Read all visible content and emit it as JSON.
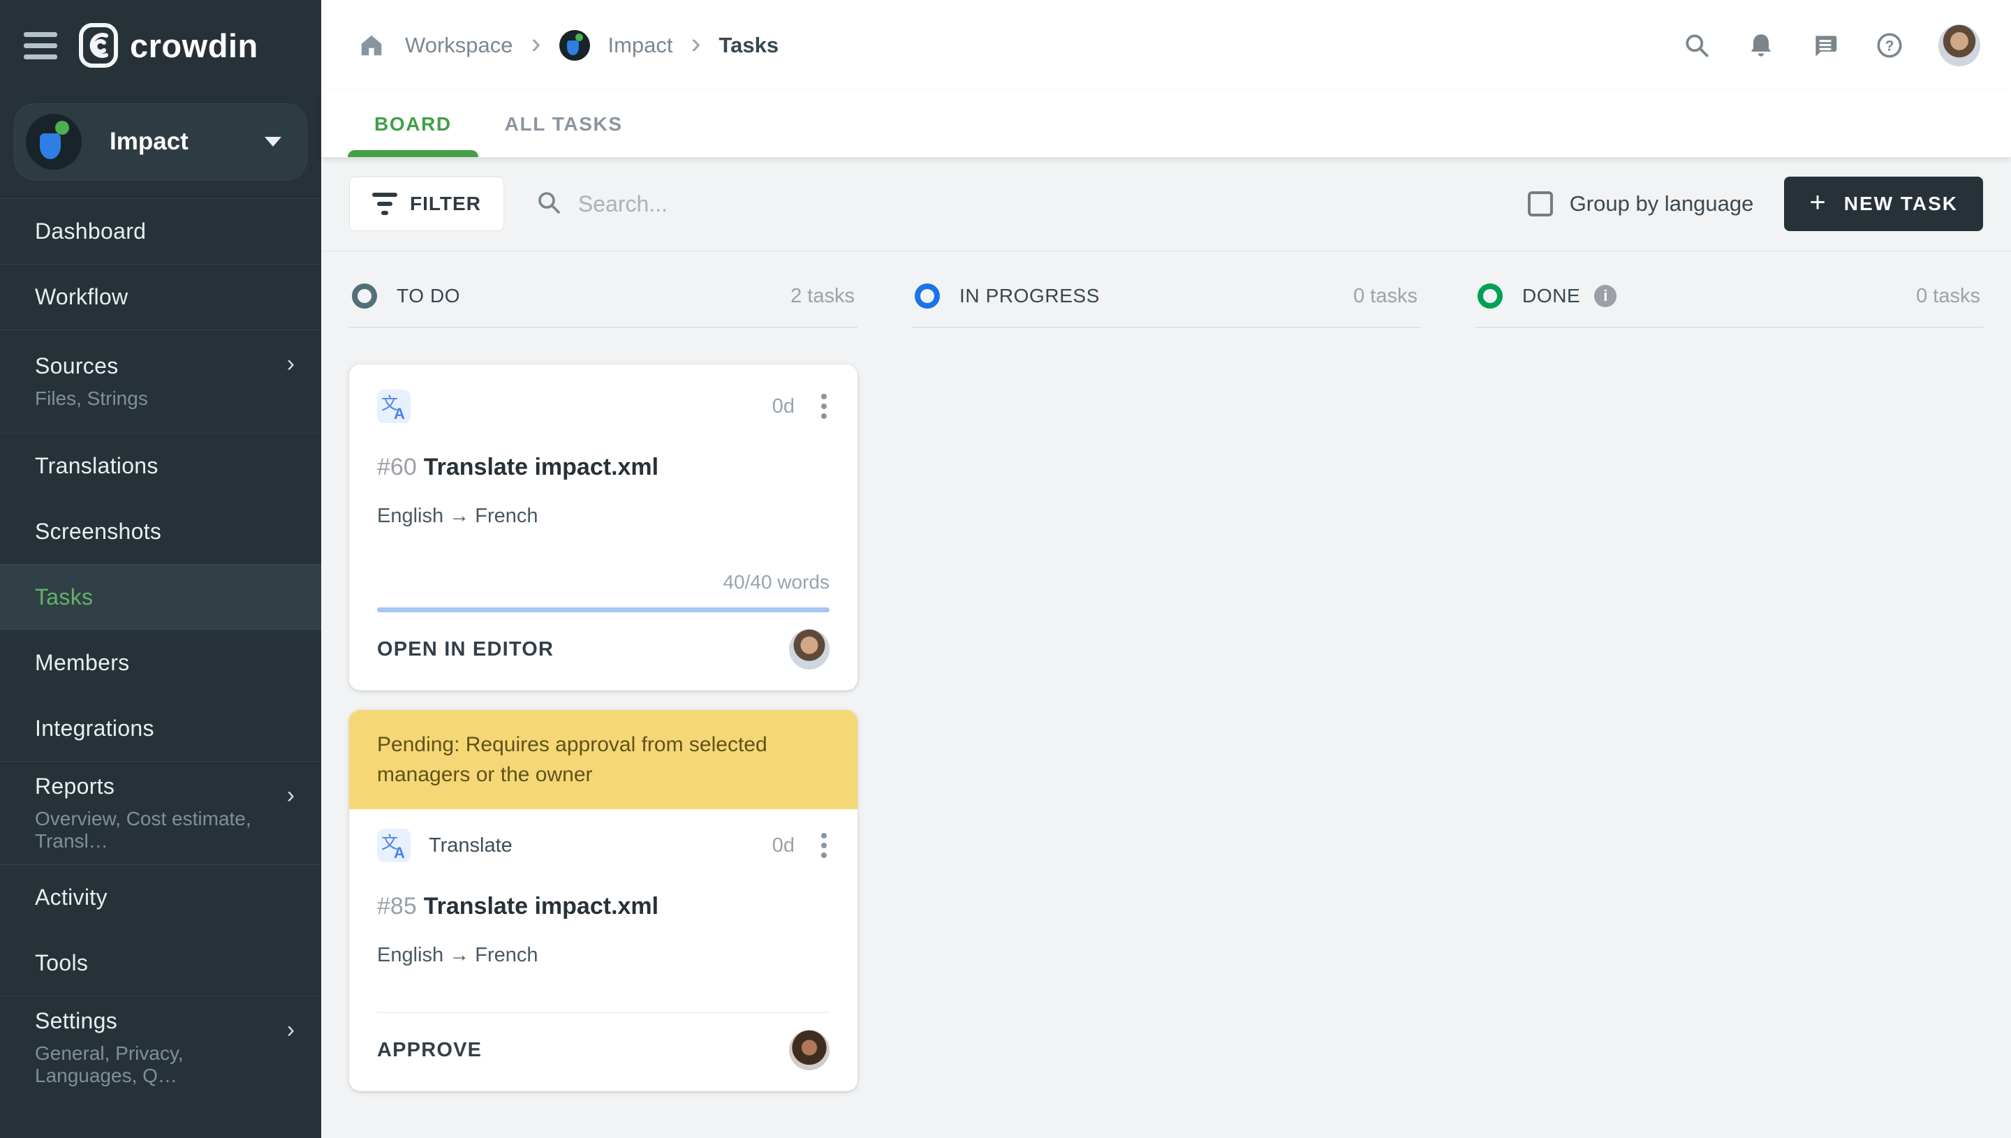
{
  "brand": {
    "name": "crowdin"
  },
  "sidebar": {
    "project": {
      "name": "Impact"
    },
    "items": [
      {
        "label": "Dashboard"
      },
      {
        "label": "Workflow"
      },
      {
        "label": "Sources",
        "subtitle": "Files, Strings"
      },
      {
        "label": "Translations"
      },
      {
        "label": "Screenshots"
      },
      {
        "label": "Tasks"
      },
      {
        "label": "Members"
      },
      {
        "label": "Integrations"
      },
      {
        "label": "Reports",
        "subtitle": "Overview, Cost estimate, Transl…"
      },
      {
        "label": "Activity"
      },
      {
        "label": "Tools"
      },
      {
        "label": "Settings",
        "subtitle": "General, Privacy, Languages, Q…"
      }
    ]
  },
  "breadcrumb": {
    "workspace": "Workspace",
    "project": "Impact",
    "page": "Tasks"
  },
  "tabs": [
    {
      "label": "BOARD",
      "active": true
    },
    {
      "label": "ALL TASKS",
      "active": false
    }
  ],
  "toolbar": {
    "filter_label": "FILTER",
    "search_placeholder": "Search...",
    "group_by_label": "Group by language",
    "new_task_plus": "+",
    "new_task_label": "NEW TASK"
  },
  "board": {
    "columns": [
      {
        "name": "TO DO",
        "count": "2 tasks",
        "color": "#546e7a"
      },
      {
        "name": "IN PROGRESS",
        "count": "0 tasks",
        "color": "#1a73e8"
      },
      {
        "name": "DONE",
        "count": "0 tasks",
        "color": "#00a154",
        "info": "i"
      }
    ],
    "cards": [
      {
        "id": "#60",
        "title": "Translate impact.xml",
        "languages": "English → French",
        "due": "0d",
        "words": "40/40 words",
        "action": "OPEN IN EDITOR"
      },
      {
        "banner": "Pending: Requires approval from selected managers or the owner",
        "type_label": "Translate",
        "id": "#85",
        "title": "Translate impact.xml",
        "languages": "English → French",
        "due": "0d",
        "action": "APPROVE"
      }
    ]
  },
  "colors": {
    "accent_green": "#43a047",
    "sidebar_bg": "#263238",
    "todo_circle": "#546e7a",
    "in_progress_circle": "#1a73e8",
    "done_circle": "#00a154",
    "banner_bg": "#f5d875",
    "progress_blue": "#a6c6f3",
    "new_task_bg": "#263238"
  }
}
